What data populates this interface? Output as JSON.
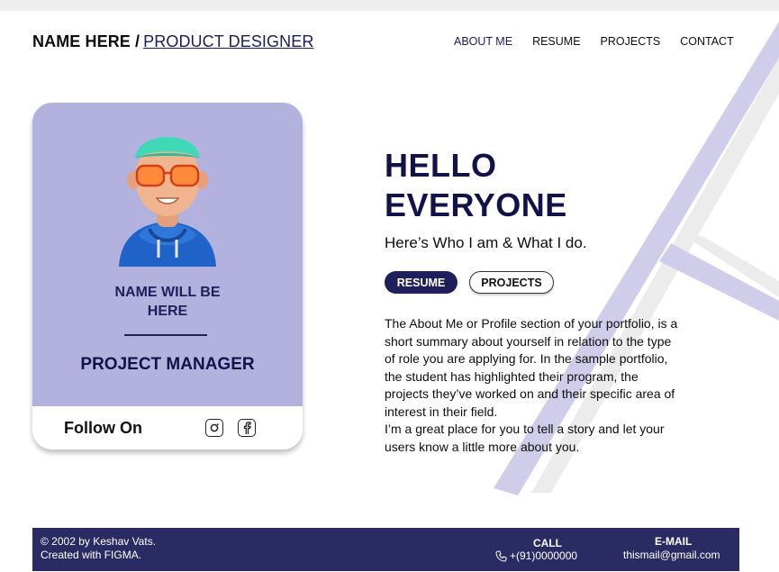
{
  "header": {
    "name": "NAME HERE",
    "separator": "/",
    "role": "PRODUCT DESIGNER",
    "nav": [
      {
        "label": "ABOUT ME"
      },
      {
        "label": "RESUME"
      },
      {
        "label": "PROJECTS"
      },
      {
        "label": "CONTACT"
      }
    ]
  },
  "card": {
    "name_line1": "NAME WILL BE",
    "name_line2": "HERE",
    "title": "PROJECT MANAGER",
    "follow_label": "Follow On",
    "social_icons": [
      "instagram-icon",
      "facebook-icon"
    ]
  },
  "hero": {
    "headline_line1": "HELLO",
    "headline_line2": "EVERYONE",
    "subtitle": "Here’s Who I am & What I do.",
    "primary_button": "RESUME",
    "secondary_button": "PROJECTS",
    "about_p1": "The About Me or Profile section of your portfolio, is a short summary about yourself in relation to the type of role you are applying for. In the sample portfolio, the student has highlighted their program, the projects they’ve worked on and their specific area of interest in their field.",
    "about_p2": "I’m a great place for you to tell a story and let your users know a little more about you."
  },
  "footer": {
    "copyright_line1": "© 2002 by Keshav Vats.",
    "copyright_line2": "Created with FIGMA.",
    "call_label": "CALL",
    "call_value": "+(91)0000000",
    "email_label": "E-MAIL",
    "email_value": "thismail@gmail.com"
  },
  "colors": {
    "accent": "#1f1f5c",
    "card_background": "#b3b2df",
    "footer_background": "#2b2b63",
    "decor_lines": "#c9c8e8"
  }
}
